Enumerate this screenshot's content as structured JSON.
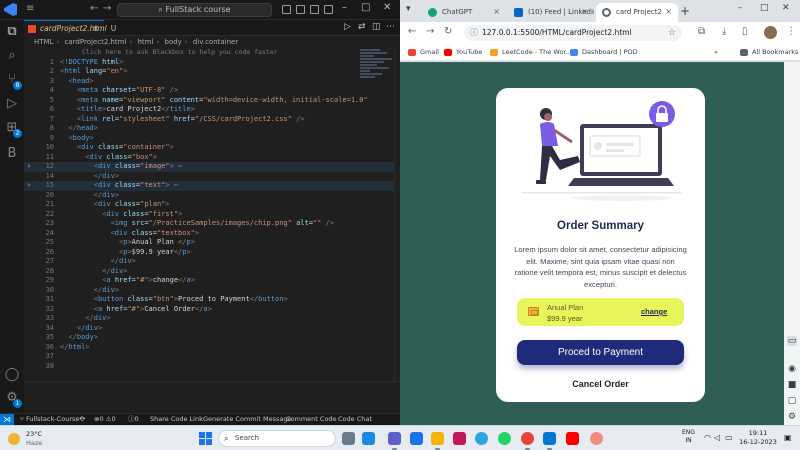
{
  "vscode": {
    "search_text": "FullStack course",
    "tab": {
      "filename": "cardProject2.html",
      "modified": "U"
    },
    "breadcrumb": [
      "HTML",
      "cardProject2.html",
      "html",
      "body",
      "div.container"
    ],
    "hint": "Click here to ask Blackbox to help you code faster",
    "lines": [
      {
        "n": "1",
        "html": "<span class='t-brk'>&lt;!</span><span class='t-tag'>DOCTYPE</span> <span class='t-att'>html</span><span class='t-brk'>&gt;</span>"
      },
      {
        "n": "2",
        "html": "<span class='t-brk'>&lt;</span><span class='t-tag'>html</span> <span class='t-att'>lang</span>=<span class='t-str'>\"en\"</span><span class='t-brk'>&gt;</span>"
      },
      {
        "n": "3",
        "html": "  <span class='t-brk'>&lt;</span><span class='t-tag'>head</span><span class='t-brk'>&gt;</span>"
      },
      {
        "n": "4",
        "html": "    <span class='t-brk'>&lt;</span><span class='t-tag'>meta</span> <span class='t-att'>charset</span>=<span class='t-str'>\"UTF-8\"</span> <span class='t-brk'>/&gt;</span>"
      },
      {
        "n": "5",
        "html": "    <span class='t-brk'>&lt;</span><span class='t-tag'>meta</span> <span class='t-att'>name</span>=<span class='t-str'>\"viewport\"</span> <span class='t-att'>content</span>=<span class='t-str'>\"width=device-width, initial-scale=1.0\"</span>"
      },
      {
        "n": "6",
        "html": "    <span class='t-brk'>&lt;</span><span class='t-tag'>title</span><span class='t-brk'>&gt;</span>card Project2<span class='t-brk'>&lt;/</span><span class='t-tag'>title</span><span class='t-brk'>&gt;</span>"
      },
      {
        "n": "7",
        "html": "    <span class='t-brk'>&lt;</span><span class='t-tag'>link</span> <span class='t-att'>rel</span>=<span class='t-str'>\"stylesheet\"</span> <span class='t-att'>href</span>=<span class='t-str'>\"/CSS/cardProject2.css\"</span> <span class='t-brk'>/&gt;</span>"
      },
      {
        "n": "8",
        "html": "  <span class='t-brk'>&lt;/</span><span class='t-tag'>head</span><span class='t-brk'>&gt;</span>"
      },
      {
        "n": "9",
        "html": "  <span class='t-brk'>&lt;</span><span class='t-tag'>body</span><span class='t-brk'>&gt;</span>"
      },
      {
        "n": "10",
        "html": "    <span class='t-brk'>&lt;</span><span class='t-tag'>div</span> <span class='t-att'>class</span>=<span class='t-str'>\"container\"</span><span class='t-brk'>&gt;</span>"
      },
      {
        "n": "11",
        "html": "      <span class='t-brk'>&lt;</span><span class='t-tag'>div</span> <span class='t-att'>class</span>=<span class='t-str'>\"box\"</span><span class='t-brk'>&gt;</span>"
      },
      {
        "n": "12",
        "fold": "›",
        "hl": true,
        "html": "        <span class='t-brk'>&lt;</span><span class='t-tag'>div</span> <span class='t-att'>class</span>=<span class='t-str'>\"image\"</span><span class='t-brk'>&gt;</span><span class='t-dim'> ⋯</span>"
      },
      {
        "n": "14",
        "html": "        <span class='t-brk'>&lt;/</span><span class='t-tag'>div</span><span class='t-brk'>&gt;</span>"
      },
      {
        "n": "15",
        "fold": "›",
        "hl": true,
        "html": "        <span class='t-brk'>&lt;</span><span class='t-tag'>div</span> <span class='t-att'>class</span>=<span class='t-str'>\"text\"</span><span class='t-brk'>&gt;</span><span class='t-dim'> ⋯</span>"
      },
      {
        "n": "20",
        "html": "        <span class='t-brk'>&lt;/</span><span class='t-tag'>div</span><span class='t-brk'>&gt;</span>"
      },
      {
        "n": "21",
        "html": "        <span class='t-brk'>&lt;</span><span class='t-tag'>div</span> <span class='t-att'>class</span>=<span class='t-str'>\"plan\"</span><span class='t-brk'>&gt;</span>"
      },
      {
        "n": "22",
        "html": "          <span class='t-brk'>&lt;</span><span class='t-tag'>div</span> <span class='t-att'>class</span>=<span class='t-str'>\"first\"</span><span class='t-brk'>&gt;</span>"
      },
      {
        "n": "23",
        "html": "            <span class='t-brk'>&lt;</span><span class='t-tag'>img</span> <span class='t-att'>src</span>=<span class='t-str'>\"/PracticeSamples/images/chip.png\"</span> <span class='t-att'>alt</span>=<span class='t-str'>\"\"</span> <span class='t-brk'>/&gt;</span>"
      },
      {
        "n": "24",
        "html": "            <span class='t-brk'>&lt;</span><span class='t-tag'>div</span> <span class='t-att'>class</span>=<span class='t-str'>\"textbox\"</span><span class='t-brk'>&gt;</span>"
      },
      {
        "n": "25",
        "html": "              <span class='t-brk'>&lt;</span><span class='t-tag'>p</span><span class='t-brk'>&gt;</span>Anual Plan <span class='t-brk'>&lt;/</span><span class='t-tag'>p</span><span class='t-brk'>&gt;</span>"
      },
      {
        "n": "26",
        "html": "              <span class='t-brk'>&lt;</span><span class='t-tag'>p</span><span class='t-brk'>&gt;</span>$99.9 year<span class='t-brk'>&lt;/</span><span class='t-tag'>p</span><span class='t-brk'>&gt;</span>"
      },
      {
        "n": "27",
        "html": "            <span class='t-brk'>&lt;/</span><span class='t-tag'>div</span><span class='t-brk'>&gt;</span>"
      },
      {
        "n": "28",
        "html": "          <span class='t-brk'>&lt;/</span><span class='t-tag'>div</span><span class='t-brk'>&gt;</span>"
      },
      {
        "n": "29",
        "html": "          <span class='t-brk'>&lt;</span><span class='t-tag'>a</span> <span class='t-att'>href</span>=<span class='t-str'>\"#\"</span><span class='t-brk'>&gt;</span>change<span class='t-brk'>&lt;/</span><span class='t-tag'>a</span><span class='t-brk'>&gt;</span>"
      },
      {
        "n": "30",
        "html": "        <span class='t-brk'>&lt;/</span><span class='t-tag'>div</span><span class='t-brk'>&gt;</span>"
      },
      {
        "n": "31",
        "html": "        <span class='t-brk'>&lt;</span><span class='t-tag'>button</span> <span class='t-att'>class</span>=<span class='t-str'>\"btn\"</span><span class='t-brk'>&gt;</span>Proced to Payment<span class='t-brk'>&lt;/</span><span class='t-tag'>button</span><span class='t-brk'>&gt;</span>"
      },
      {
        "n": "32",
        "html": "        <span class='t-brk'>&lt;</span><span class='t-tag'>a</span> <span class='t-att'>href</span>=<span class='t-str'>\"#\"</span><span class='t-brk'>&gt;</span>Cancel Order<span class='t-brk'>&lt;/</span><span class='t-tag'>a</span><span class='t-brk'>&gt;</span>"
      },
      {
        "n": "33",
        "html": "      <span class='t-brk'>&lt;/</span><span class='t-tag'>div</span><span class='t-brk'>&gt;</span>"
      },
      {
        "n": "34",
        "html": "    <span class='t-brk'>&lt;/</span><span class='t-tag'>div</span><span class='t-brk'>&gt;</span>"
      },
      {
        "n": "35",
        "html": "  <span class='t-brk'>&lt;/</span><span class='t-tag'>body</span><span class='t-brk'>&gt;</span>"
      },
      {
        "n": "36",
        "html": "<span class='t-brk'>&lt;/</span><span class='t-tag'>html</span><span class='t-brk'>&gt;</span>"
      },
      {
        "n": "37",
        "html": ""
      },
      {
        "n": "38",
        "html": ""
      }
    ],
    "status": {
      "branch": "Fullstack-Course*",
      "errors": "0",
      "warnings": "0",
      "info": "0",
      "share": "Share Code Link",
      "generate": "Generate Commit Message",
      "comment": "Comment Code",
      "chat": "Code Chat"
    }
  },
  "browser": {
    "tabs": [
      {
        "label": "ChatGPT",
        "color": "#10a37f"
      },
      {
        "label": "(10) Feed | LinkedIn",
        "color": "#0a66c2"
      },
      {
        "label": "card Project2",
        "color": "#5f6368"
      }
    ],
    "url": "127.0.0.1:5500/HTML/cardProject2.html",
    "bookmarks": [
      {
        "label": "Gmail",
        "color": "#ea4335"
      },
      {
        "label": "YouTube",
        "color": "#ff0000"
      },
      {
        "label": "LeetCode - The Wor...",
        "color": "#f89f1b"
      },
      {
        "label": "Dashboard | POD",
        "color": "#4285f4"
      }
    ],
    "all_bookmarks": "All Bookmarks",
    "background": "#2f5e58"
  },
  "card": {
    "title": "Order Summary",
    "description": "Lorem ipsum dolor sit amet, consectetur adipisicing elit. Maxime, sint quia ipsam vitae quasi non ratione velit tempora est, minus suscipit et delectus excepturi.",
    "plan_name": "Anual Plan",
    "plan_price": "$99.9 year",
    "change_label": "change",
    "pay_label": "Proced to Payment",
    "cancel_label": "Cancel Order",
    "accent": "#7b5ce6",
    "plan_bg": "#e8f55a",
    "button_color": "#1f2b7a"
  },
  "taskbar": {
    "temp": "23°C",
    "condition": "Haze",
    "search_placeholder": "Search",
    "lang_1": "ENG",
    "lang_2": "IN",
    "time": "19:11",
    "date": "16-12-2023"
  }
}
